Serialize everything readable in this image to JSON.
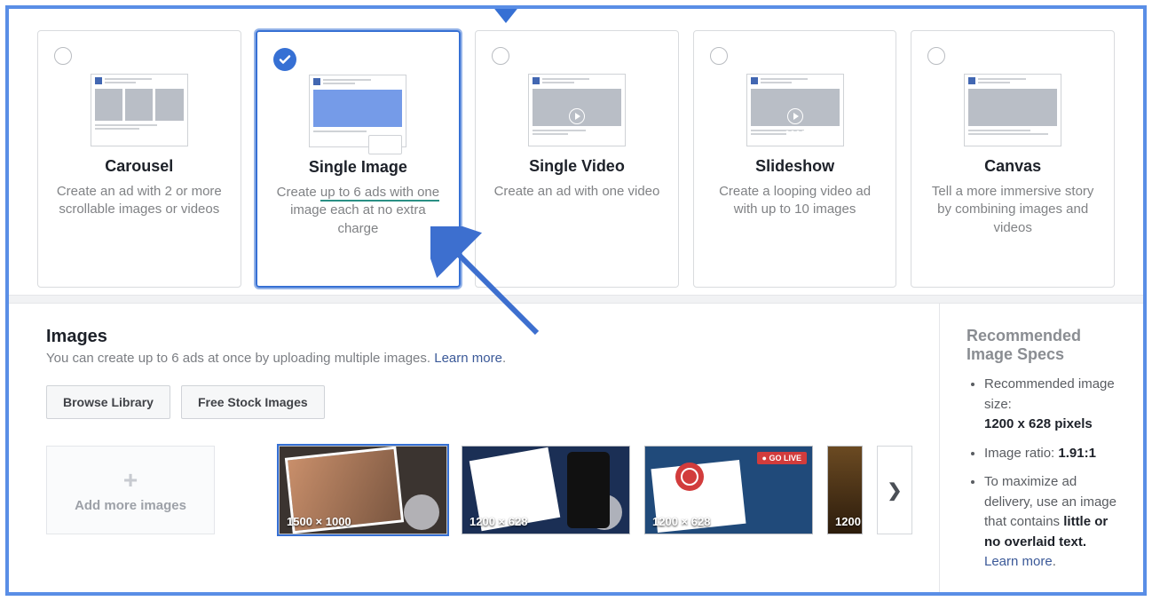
{
  "formats": [
    {
      "title": "Carousel",
      "desc": "Create an ad with 2 or more scrollable images or videos"
    },
    {
      "title": "Single Image",
      "desc_pre": "Create ",
      "desc_underlined": "up to 6 ads with one",
      "desc_post": " image each at no extra charge"
    },
    {
      "title": "Single Video",
      "desc": "Create an ad with one video"
    },
    {
      "title": "Slideshow",
      "desc": "Create a looping video ad with up to 10 images"
    },
    {
      "title": "Canvas",
      "desc": "Tell a more immersive story by combining images and videos"
    }
  ],
  "images_section": {
    "title": "Images",
    "sub": "You can create up to 6 ads at once by uploading multiple images. ",
    "learn_more": "Learn more",
    "browse": "Browse Library",
    "stock": "Free Stock Images",
    "add_more": "Add more images"
  },
  "thumbs": [
    {
      "label": "1500 × 1000"
    },
    {
      "label": "1200 × 628"
    },
    {
      "label": "1200 × 628",
      "tag": "GO LIVE"
    },
    {
      "label": "1200"
    }
  ],
  "specs": {
    "title": "Recommended Image Specs",
    "size_label": "Recommended image size:",
    "size_value": "1200 x 628 pixels",
    "ratio_label": "Image ratio: ",
    "ratio_value": "1.91:1",
    "tip_pre": "To maximize ad delivery, use an image that contains ",
    "tip_bold": "little or no overlaid text.",
    "learn_more": "Learn more"
  }
}
